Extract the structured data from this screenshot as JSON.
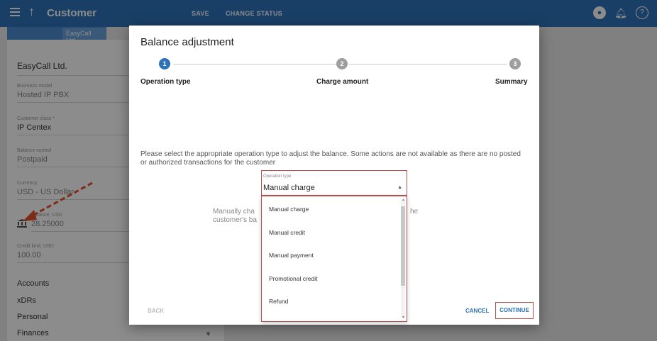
{
  "appbar": {
    "title": "Customer",
    "save_label": "SAVE",
    "change_status_label": "CHANGE STATUS"
  },
  "subbar": {
    "chip": "EasyCall Ltd."
  },
  "sidebar": {
    "customer_name": "EasyCall Ltd.",
    "fields": [
      {
        "label": "Business model",
        "value": "Hosted IP PBX"
      },
      {
        "label": "Customer class *",
        "value": "IP Centex"
      },
      {
        "label": "Balance control",
        "value": "Postpaid"
      },
      {
        "label": "Currency",
        "value": "USD - US Dollar"
      },
      {
        "label": "Balance, USD",
        "value": "28.25000"
      },
      {
        "label": "Credit limit, USD",
        "value": "100.00"
      }
    ],
    "nav": [
      "Accounts",
      "xDRs",
      "Personal",
      "Finances"
    ]
  },
  "dialog": {
    "title": "Balance adjustment",
    "steps": [
      {
        "num": "1",
        "label": "Operation type"
      },
      {
        "num": "2",
        "label": "Charge amount"
      },
      {
        "num": "3",
        "label": "Summary"
      }
    ],
    "instruction": "Please select the appropriate operation type to adjust the balance. Some actions are not available as there are no posted or authorized transactions for the customer",
    "select": {
      "label": "Operation type",
      "value": "Manual charge"
    },
    "hint_left": "Manually cha customer's ba",
    "hint_right": "he",
    "options": [
      "Manual charge",
      "Manual credit",
      "Manual payment",
      "Promotional credit",
      "Refund"
    ],
    "back_label": "BACK",
    "cancel_label": "CANCEL",
    "continue_label": "CONTINUE"
  },
  "colors": {
    "accent": "#2e73ba",
    "highlight": "#c0504d",
    "annotation_arrow": "#e4502a"
  }
}
